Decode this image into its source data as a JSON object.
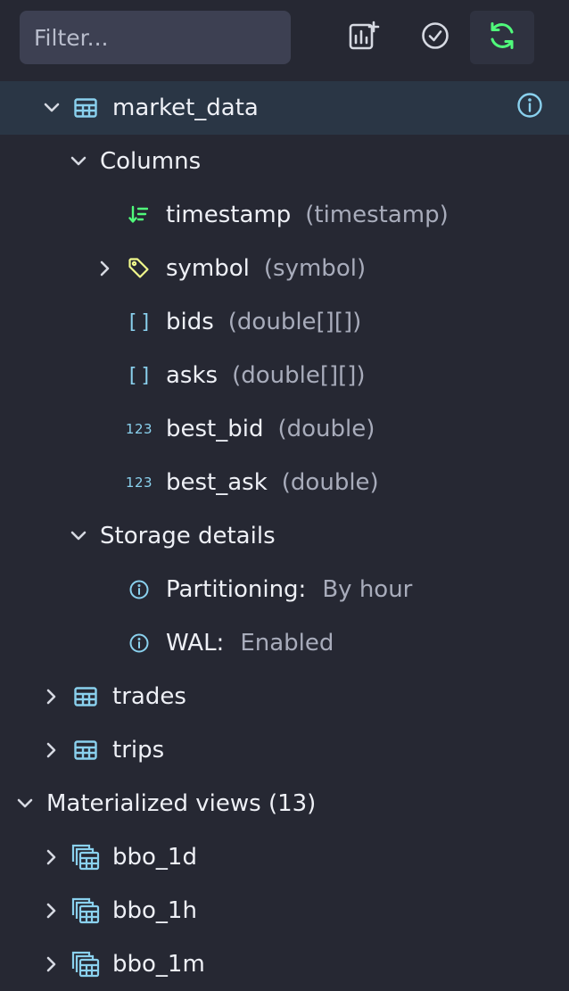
{
  "filter": {
    "placeholder": "Filter..."
  },
  "toolbar": {
    "icons": [
      "add-chart-icon",
      "check-circle-icon",
      "refresh-icon"
    ],
    "accent": "#50fa7b"
  },
  "tree": {
    "table_market_data": {
      "label": "market_data",
      "columns_group": "Columns",
      "columns": [
        {
          "name": "timestamp",
          "type": "(timestamp)",
          "icon": "sort-designated-timestamp-icon"
        },
        {
          "name": "symbol",
          "type": "(symbol)",
          "icon": "tag-icon"
        },
        {
          "name": "bids",
          "type": "(double[][])",
          "icon": "array-icon",
          "glyph": "[]"
        },
        {
          "name": "asks",
          "type": "(double[][])",
          "icon": "array-icon",
          "glyph": "[]"
        },
        {
          "name": "best_bid",
          "type": "(double)",
          "icon": "number-icon",
          "glyph": "123"
        },
        {
          "name": "best_ask",
          "type": "(double)",
          "icon": "number-icon",
          "glyph": "123"
        }
      ],
      "storage_group": "Storage details",
      "storage": [
        {
          "key": "Partitioning:",
          "value": "By hour"
        },
        {
          "key": "WAL:",
          "value": "Enabled"
        }
      ]
    },
    "tables": [
      {
        "label": "trades"
      },
      {
        "label": "trips"
      }
    ],
    "materialized_views": {
      "label": "Materialized views (13)",
      "items": [
        {
          "label": "bbo_1d"
        },
        {
          "label": "bbo_1h"
        },
        {
          "label": "bbo_1m"
        }
      ]
    }
  },
  "colors": {
    "background": "#262833",
    "selected_row": "#2a3645",
    "icon_blue": "#8ad1ee",
    "icon_green": "#50fa7b",
    "icon_yellow": "#f1fa8c",
    "muted_text": "#a8acbb"
  }
}
